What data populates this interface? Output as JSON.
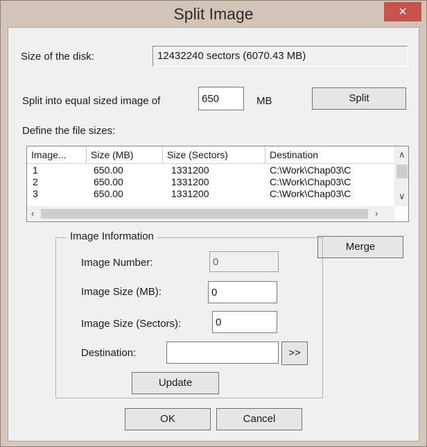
{
  "window": {
    "title": "Split Image",
    "close_symbol": "×"
  },
  "disk": {
    "label": "Size of the disk:",
    "value": "12432240 sectors (6070.43 MB)"
  },
  "split": {
    "label": "Split into equal sized image of",
    "value": "650",
    "unit": "MB",
    "button": "Split"
  },
  "define_label": "Define the file sizes:",
  "list": {
    "columns": [
      "Image...",
      "Size (MB)",
      "Size (Sectors)",
      "Destination"
    ],
    "rows": [
      [
        "1",
        "650.00",
        "1331200",
        "C:\\Work\\Chap03\\C"
      ],
      [
        "2",
        "650.00",
        "1331200",
        "C:\\Work\\Chap03\\C"
      ],
      [
        "3",
        "650.00",
        "1331200",
        "C:\\Work\\Chap03\\C"
      ]
    ]
  },
  "merge_button": "Merge",
  "image_info": {
    "title": "Image Information",
    "number_label": "Image Number:",
    "number_value": "0",
    "size_mb_label": "Image Size (MB):",
    "size_mb_value": "0",
    "size_sectors_label": "Image Size (Sectors):",
    "size_sectors_value": "0",
    "destination_label": "Destination:",
    "destination_value": "",
    "browse_button": ">>",
    "update_button": "Update"
  },
  "ok_button": "OK",
  "cancel_button": "Cancel"
}
